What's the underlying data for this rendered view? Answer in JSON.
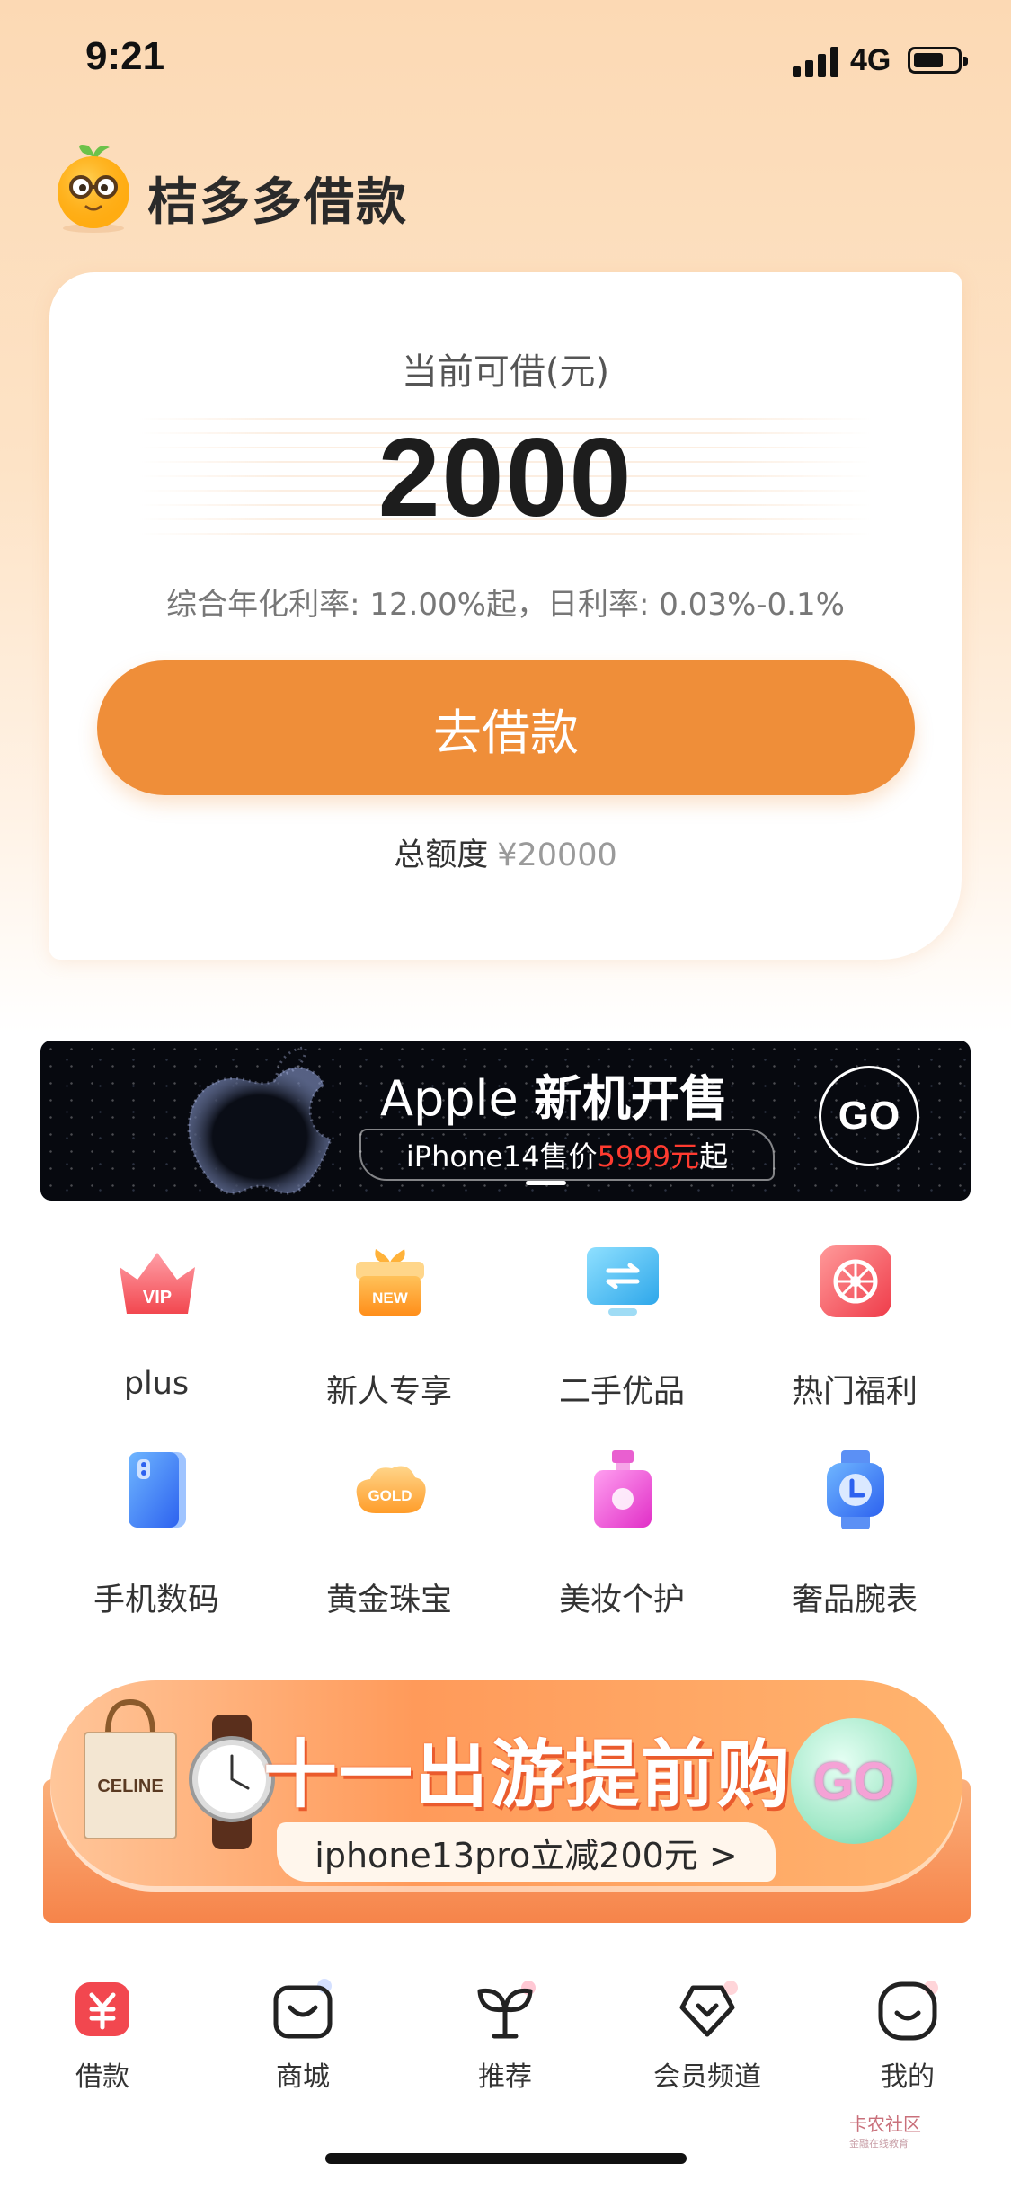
{
  "status_bar": {
    "time": "9:21",
    "network": "4G"
  },
  "app": {
    "name": "桔多多借款"
  },
  "loan_card": {
    "label": "当前可借(元)",
    "amount": "2000",
    "rate_text": "综合年化利率: 12.00%起，日利率: 0.03%-0.1%",
    "button_label": "去借款",
    "total_label": "总额度",
    "total_value": "¥20000"
  },
  "apple_banner": {
    "title_prefix": "Apple",
    "title_main": "新机开售",
    "sub_prefix": "iPhone14售价",
    "sub_price": "5999元",
    "sub_suffix": "起",
    "go_label": "GO"
  },
  "categories": [
    {
      "label": "plus",
      "icon": "vip-crown-icon",
      "badge": "VIP"
    },
    {
      "label": "新人专享",
      "icon": "new-gift-icon",
      "badge": "NEW"
    },
    {
      "label": "二手优品",
      "icon": "exchange-icon"
    },
    {
      "label": "热门福利",
      "icon": "gift-wheel-icon"
    },
    {
      "label": "手机数码",
      "icon": "phone-icon"
    },
    {
      "label": "黄金珠宝",
      "icon": "gold-icon",
      "badge": "GOLD"
    },
    {
      "label": "美妆个护",
      "icon": "perfume-icon"
    },
    {
      "label": "奢品腕表",
      "icon": "watch-icon"
    }
  ],
  "promo_banner": {
    "title": "十一出游提前购",
    "subtitle": "iphone13pro立减200元 >",
    "go_label": "GO",
    "bag_text": "CELINE"
  },
  "bottom_nav": [
    {
      "label": "借款",
      "icon": "loan-yuan-icon",
      "active": true
    },
    {
      "label": "商城",
      "icon": "mall-bag-icon"
    },
    {
      "label": "推荐",
      "icon": "sprout-icon"
    },
    {
      "label": "会员频道",
      "icon": "member-diamond-icon"
    },
    {
      "label": "我的",
      "icon": "profile-face-icon"
    }
  ],
  "watermark": {
    "text": "卡农社区",
    "subtext": "金融在线教育"
  },
  "colors": {
    "accent": "#ef8e39",
    "price_red": "#ff3b30",
    "nav_active": "#f2474f"
  }
}
